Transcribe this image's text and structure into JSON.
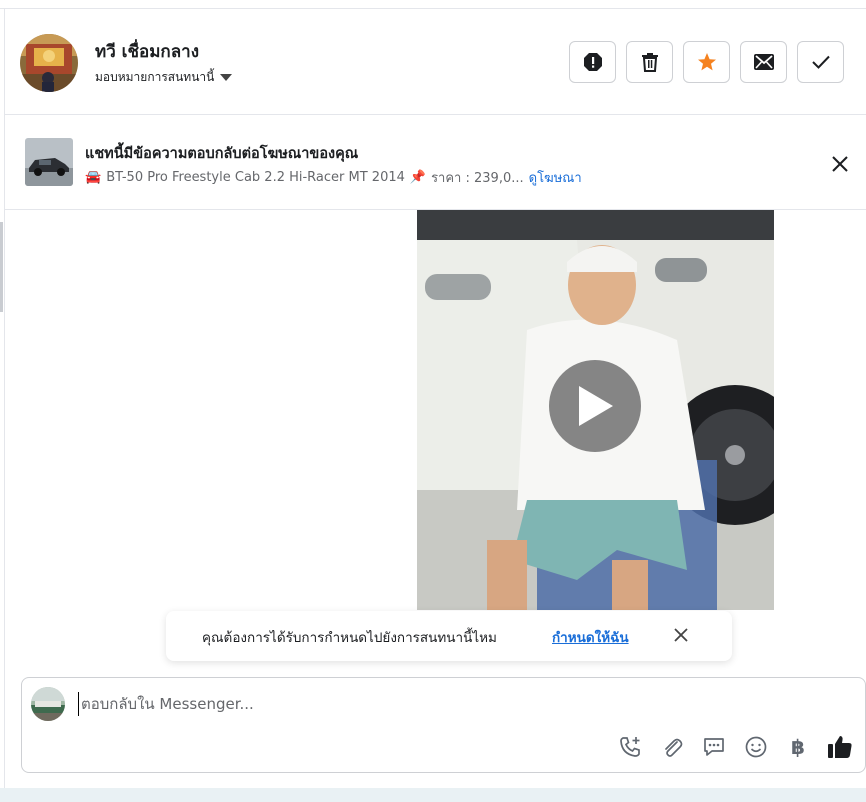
{
  "header": {
    "contact_name": "ทวี เชื่อมกลาง",
    "assign_label": "มอบหมายการสนทนานี้",
    "actions": [
      {
        "icon": "alert-octagon-icon",
        "label": "spam"
      },
      {
        "icon": "trash-icon",
        "label": "delete"
      },
      {
        "icon": "star-icon",
        "label": "follow-up"
      },
      {
        "icon": "envelope-icon",
        "label": "mark-unread"
      },
      {
        "icon": "check-icon",
        "label": "done"
      }
    ]
  },
  "ad_reply": {
    "title": "แชทนี้มีข้อความตอบกลับต่อโฆษณาของคุณ",
    "car_emoji": "🚘",
    "vehicle": "BT-50 Pro Freestyle Cab 2.2 Hi-Racer MT 2014",
    "pin_emoji": "📌",
    "price": "ราคา : 239,0...",
    "view_ad_link": "ดูโฆษณา"
  },
  "media": {
    "type": "video",
    "play_icon": "play-icon"
  },
  "assign_prompt": {
    "text": "คุณต้องการได้รับการกำหนดไปยังการสนทนานี้ไหม",
    "link": "กำหนดให้ฉัน"
  },
  "composer": {
    "placeholder": "ตอบกลับใน Messenger...",
    "value": "",
    "tools": [
      "phone-plus-icon",
      "paperclip-icon",
      "chat-bubble-icon",
      "smiley-icon",
      "baht-icon",
      "thumbs-up-icon"
    ],
    "baht_symbol": "฿"
  },
  "colors": {
    "accent_blue": "#1a6ed8",
    "star_orange": "#f5821f",
    "border": "#ced0d4"
  }
}
